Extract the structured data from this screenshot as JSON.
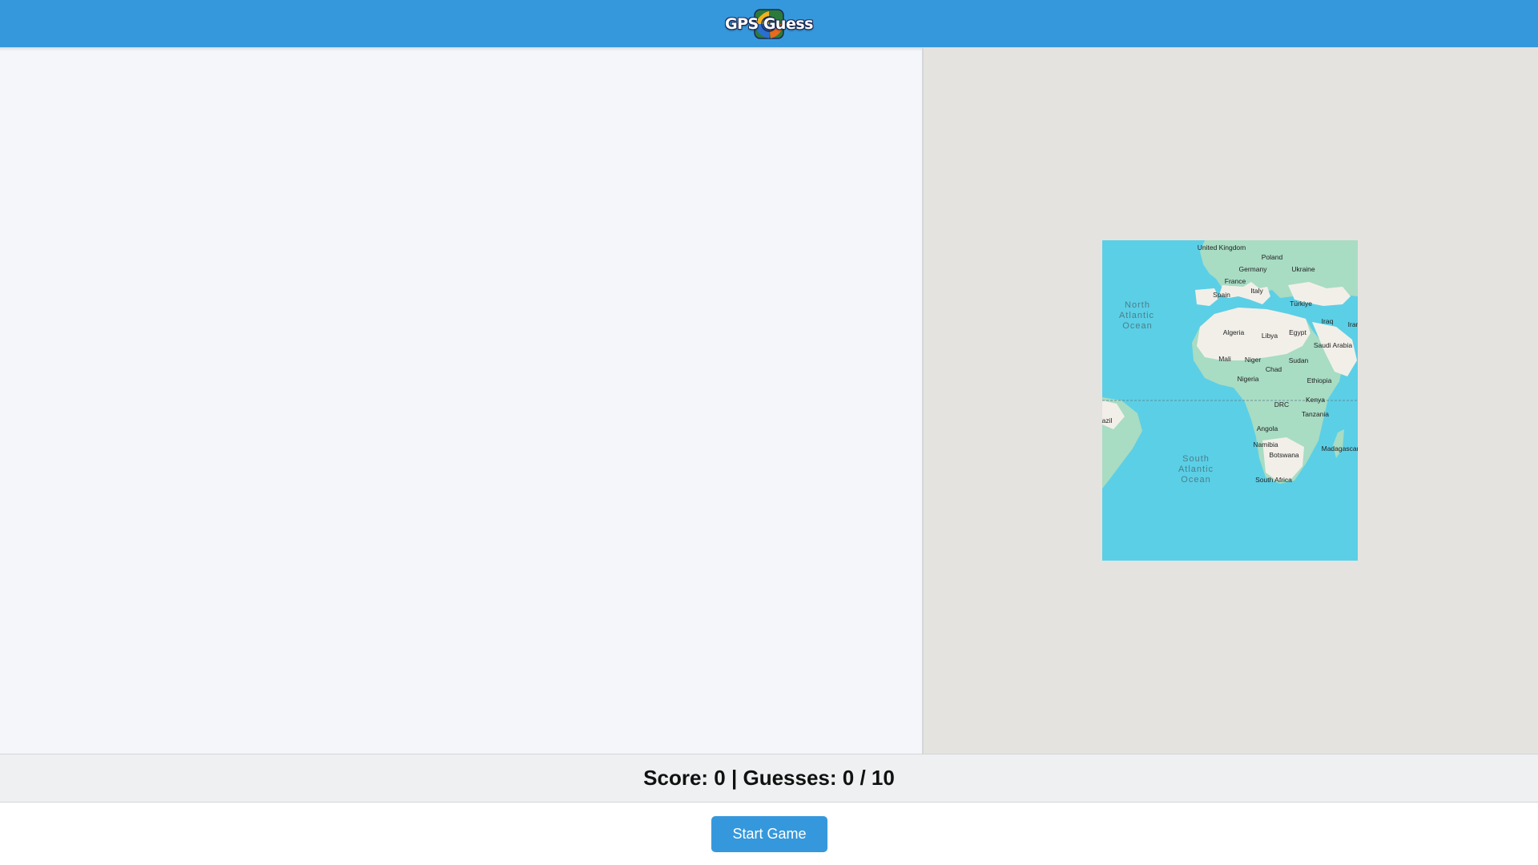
{
  "header": {
    "logo_text": "GPS Guess",
    "logo_icon": "globe-icon"
  },
  "map": {
    "oceans": [
      {
        "id": "north-atlantic",
        "lines": [
          "North",
          "Atlantic",
          "Ocean"
        ]
      },
      {
        "id": "south-atlantic",
        "lines": [
          "South",
          "Atlantic",
          "Ocean"
        ]
      }
    ],
    "labels": {
      "uk": "United Kingdom",
      "poland": "Poland",
      "germany": "Germany",
      "ukraine": "Ukraine",
      "france": "France",
      "italy": "Italy",
      "spain": "Spain",
      "turkiye": "Türkiye",
      "iraq": "Iraq",
      "iran": "Iran",
      "algeria": "Algeria",
      "libya": "Libya",
      "egypt": "Egypt",
      "saudi": "Saudi Arabia",
      "mali": "Mali",
      "niger": "Niger",
      "sudan": "Sudan",
      "chad": "Chad",
      "nigeria": "Nigeria",
      "ethiopia": "Ethiopia",
      "kenya": "Kenya",
      "drc": "DRC",
      "brazil": "azil",
      "tanzania": "Tanzania",
      "angola": "Angola",
      "namibia": "Namibia",
      "botswana": "Botswana",
      "madagascar": "Madagascar",
      "south_africa": "South Africa"
    },
    "colors": {
      "ocean": "#5bcfe6",
      "land": "#f2efe9",
      "vegetation": "#a8dcc3",
      "background": "#e5e3df"
    }
  },
  "status": {
    "score_text": "Score: 0 | Guesses: 0 / 10"
  },
  "actions": {
    "start_label": "Start Game"
  },
  "colors": {
    "accent": "#3698dc"
  }
}
